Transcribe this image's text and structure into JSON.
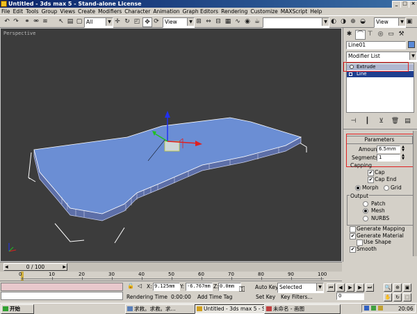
{
  "window": {
    "title": "Untitled - 3ds max 5 - Stand-alone License"
  },
  "menu": [
    "File",
    "Edit",
    "Tools",
    "Group",
    "Views",
    "Create",
    "Modifiers",
    "Character",
    "Animation",
    "Graph Editors",
    "Rendering",
    "Customize",
    "MAXScript",
    "Help"
  ],
  "toolbar": {
    "selection_filter": "All",
    "ref_coord": "View",
    "right_view": "View"
  },
  "viewport": {
    "label": "Perspective"
  },
  "panel": {
    "object_name": "Line01",
    "modifier_list": "Modifier List",
    "stack": [
      "Extrude",
      "Line"
    ],
    "parameters_title": "Parameters",
    "amount_label": "Amount:",
    "amount_value": "6.5mm",
    "segments_label": "Segments:",
    "segments_value": "1",
    "capping_label": "Capping",
    "cap_start": "Cap",
    "cap_end": "Cap End",
    "morph": "Morph",
    "grid": "Grid",
    "output_label": "Output",
    "patch": "Patch",
    "mesh": "Mesh",
    "nurbs": "NURBS",
    "gen_mapping": "Generate Mapping",
    "gen_material": "Generate Material",
    "use_shape": "Use Shape",
    "smooth": "Smooth"
  },
  "timeline": {
    "frame_counter": "0 / 100",
    "ticks": [
      "0",
      "10",
      "20",
      "30",
      "40",
      "50",
      "60",
      "70",
      "80",
      "90",
      "100"
    ]
  },
  "status": {
    "x_label": "X:",
    "x_value": "9.125mm",
    "y_label": "Y:",
    "y_value": "-6.767mm",
    "z_label": "Z:",
    "z_value": "0.0mm",
    "render_time_label": "Rendering Time",
    "render_time_value": "0:00:00",
    "add_time_tag": "Add Time Tag",
    "auto_key": "Auto Key",
    "set_key": "Set Key",
    "selected": "Selected",
    "key_filters": "Key Filters...",
    "frame": "0"
  },
  "taskbar": {
    "start": "开始",
    "tasks": [
      "求救。求救。求...",
      "Untitled - 3ds max 5 - Sta...",
      "未命名 - 画图"
    ],
    "clock": "20:06"
  },
  "colors": {
    "slab_top": "#6b8ed4",
    "viewport_bg": "#3c3c3c",
    "highlight_red": "#e02020",
    "title_blue": "#0a246a"
  }
}
